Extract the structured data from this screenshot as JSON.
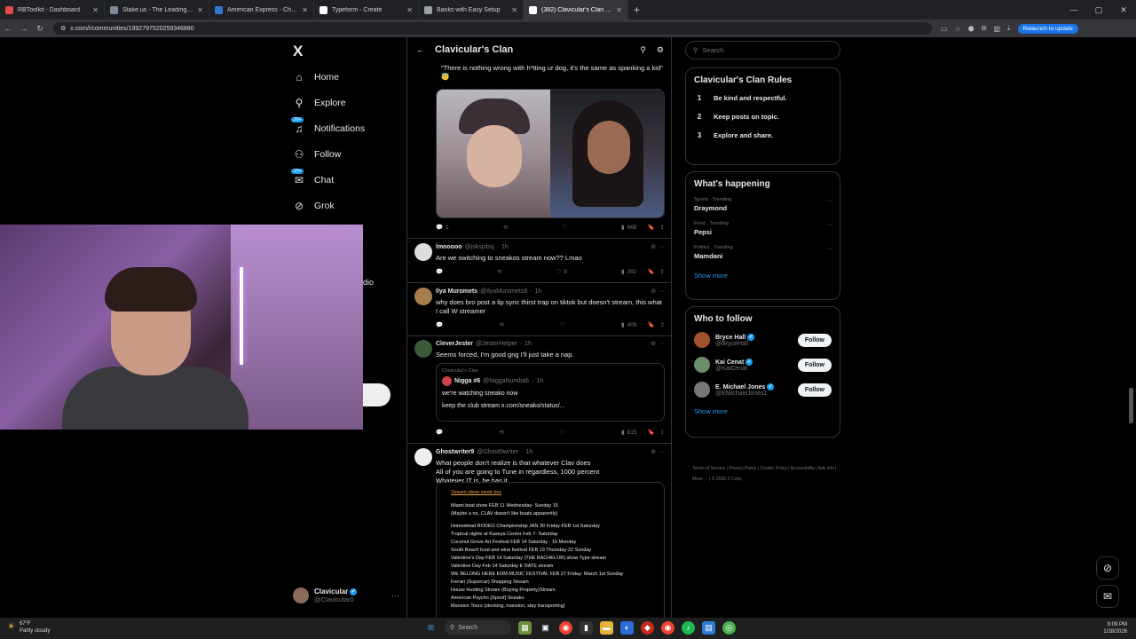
{
  "browser": {
    "tabs": [
      {
        "title": "RBToolkit - Dashboard",
        "color": "#e54b4b",
        "active": false
      },
      {
        "title": "Stake.us - The Leading Social C",
        "color": "#7a8c9a",
        "active": false
      },
      {
        "title": "American Express - Charge Veri",
        "color": "#2e77d0",
        "active": false
      },
      {
        "title": "Typeform - Create",
        "color": "#ffffff",
        "active": false
      },
      {
        "title": "Banks with Easy Setup",
        "color": "#9aa0a6",
        "active": false
      },
      {
        "title": "(382) Clavicular's Clan Commu",
        "color": "#ffffff",
        "active": true
      }
    ],
    "url": "x.com/i/communities/1992797520259346880",
    "relaunch_label": "Relaunch to update"
  },
  "sidebar": {
    "logo": "X",
    "items": [
      {
        "label": "Home",
        "icon": "⌂",
        "badge": ""
      },
      {
        "label": "Explore",
        "icon": "⚲",
        "badge": ""
      },
      {
        "label": "Notifications",
        "icon": "♫",
        "badge": "20+"
      },
      {
        "label": "Follow",
        "icon": "⚇",
        "badge": ""
      },
      {
        "label": "Chat",
        "icon": "✉",
        "badge": "20+"
      },
      {
        "label": "Grok",
        "icon": "⊘",
        "badge": ""
      }
    ],
    "partial_text": "dio",
    "profile": {
      "name": "Clavicular",
      "handle": "@Clavicular0"
    }
  },
  "feed": {
    "title": "Clavicular's Clan",
    "first_post": {
      "quote": "\"There is nothing wrong with h*tting ur dog, it's the same as spanking a kid\" 😇",
      "replies": "1",
      "views": "668"
    },
    "posts": [
      {
        "name": "lmooooo",
        "handle": "@jsksjsbsj",
        "time": "1h",
        "text": "Are we switching to sneakos stream now?? Lmao",
        "replies": "",
        "likes": "8",
        "views": "392",
        "avatar_color": "#ddd"
      },
      {
        "name": "Ilya Muromets",
        "handle": "@IlyaMuromets8",
        "time": "1h",
        "text": "why does bro post a lip sync thirst trap on tiktok but doesn't stream, this what I call W streamer",
        "replies": "",
        "likes": "",
        "views": "409",
        "avatar_color": "#a57d4e"
      },
      {
        "name": "CleverJester",
        "handle": "@JesterHelper",
        "time": "1h",
        "text": "Seems forced, I'm good gng I'll just take a nap.",
        "replies": "",
        "likes": "",
        "views": "815",
        "avatar_color": "#3a5a3a",
        "quote": {
          "community": "Clavicular's Clan",
          "name": "Nigga #6",
          "handle": "@NiggaNumba6",
          "time": "1h",
          "line1": "we're watching sneako now",
          "line2": "keep the club stream x.com/sneako/status/..."
        }
      },
      {
        "name": "Ghostwriter9",
        "handle": "@Ghost9writer",
        "time": "1h",
        "text": "What people don't realize is that whatever Clav does\nAll of you are going to Tune in regardless, 1000 percent\nWhatever IT is, he has it",
        "avatar_color": "#eee"
      }
    ],
    "doc": {
      "title": "Stream ideas week two",
      "lines": [
        "Miami boat show FEB 11 Wednesday- Sunday 15",
        "(Maybe a no, CLAV doesn't like boats apparently)",
        "",
        "Homestead RODEO Championship JAN 30 Friday-FEB 1st Saturday",
        "Tropical nights at Kaseya Center Feb 7- Saturday",
        "Coconut Grove Art Festival FEB 14 Saturday - 16 Monday",
        "South Beach food and wine festival FEB 19 Thursday-22 Sunday",
        "Valentine's Day FEB 14 Saturday (THE BACHELOR) show Type stream",
        "Valentine Day Feb 14 Saturday  E DATE stream",
        "WE BELONG HERE EDM MUSIC FESTIVAL FEB 27 Friday- March 1st Sunday",
        "Ferrari (Supercar) Shopping Stream",
        "House Hunting Stream (Buying Property)Stream",
        "American Psycho (Spoof) Sneako",
        "Mansion Tours (stocking, mansion, stay transporting)"
      ]
    }
  },
  "right": {
    "search_placeholder": "Search",
    "rules_title": "Clavicular's Clan Rules",
    "rules": [
      {
        "n": "1",
        "text": "Be kind and respectful."
      },
      {
        "n": "2",
        "text": "Keep posts on topic."
      },
      {
        "n": "3",
        "text": "Explore and share."
      }
    ],
    "happening_title": "What's happening",
    "trends": [
      {
        "cat": "Sports · Trending",
        "name": "Draymond"
      },
      {
        "cat": "Food · Trending",
        "name": "Pepsi"
      },
      {
        "cat": "Politics · Trending",
        "name": "Mamdani"
      }
    ],
    "show_more": "Show more",
    "wtf_title": "Who to follow",
    "follow_label": "Follow",
    "suggestions": [
      {
        "name": "Bryce Hall",
        "handle": "@BryceHall",
        "color": "#a0522d"
      },
      {
        "name": "Kai Cenat",
        "handle": "@KaiCenat",
        "color": "#6b8e6b"
      },
      {
        "name": "E. Michael Jones",
        "handle": "@EMichaelJones1",
        "color": "#777"
      }
    ],
    "footer": [
      "Terms of Service",
      "Privacy Policy",
      "Cookie Policy",
      "Accessibility",
      "Ads info",
      "More ···",
      "© 2026 X Corp."
    ]
  },
  "taskbar": {
    "temp": "67°F",
    "weather": "Partly cloudy",
    "search": "Search",
    "time": "8:09 PM",
    "date": "1/28/2026"
  }
}
